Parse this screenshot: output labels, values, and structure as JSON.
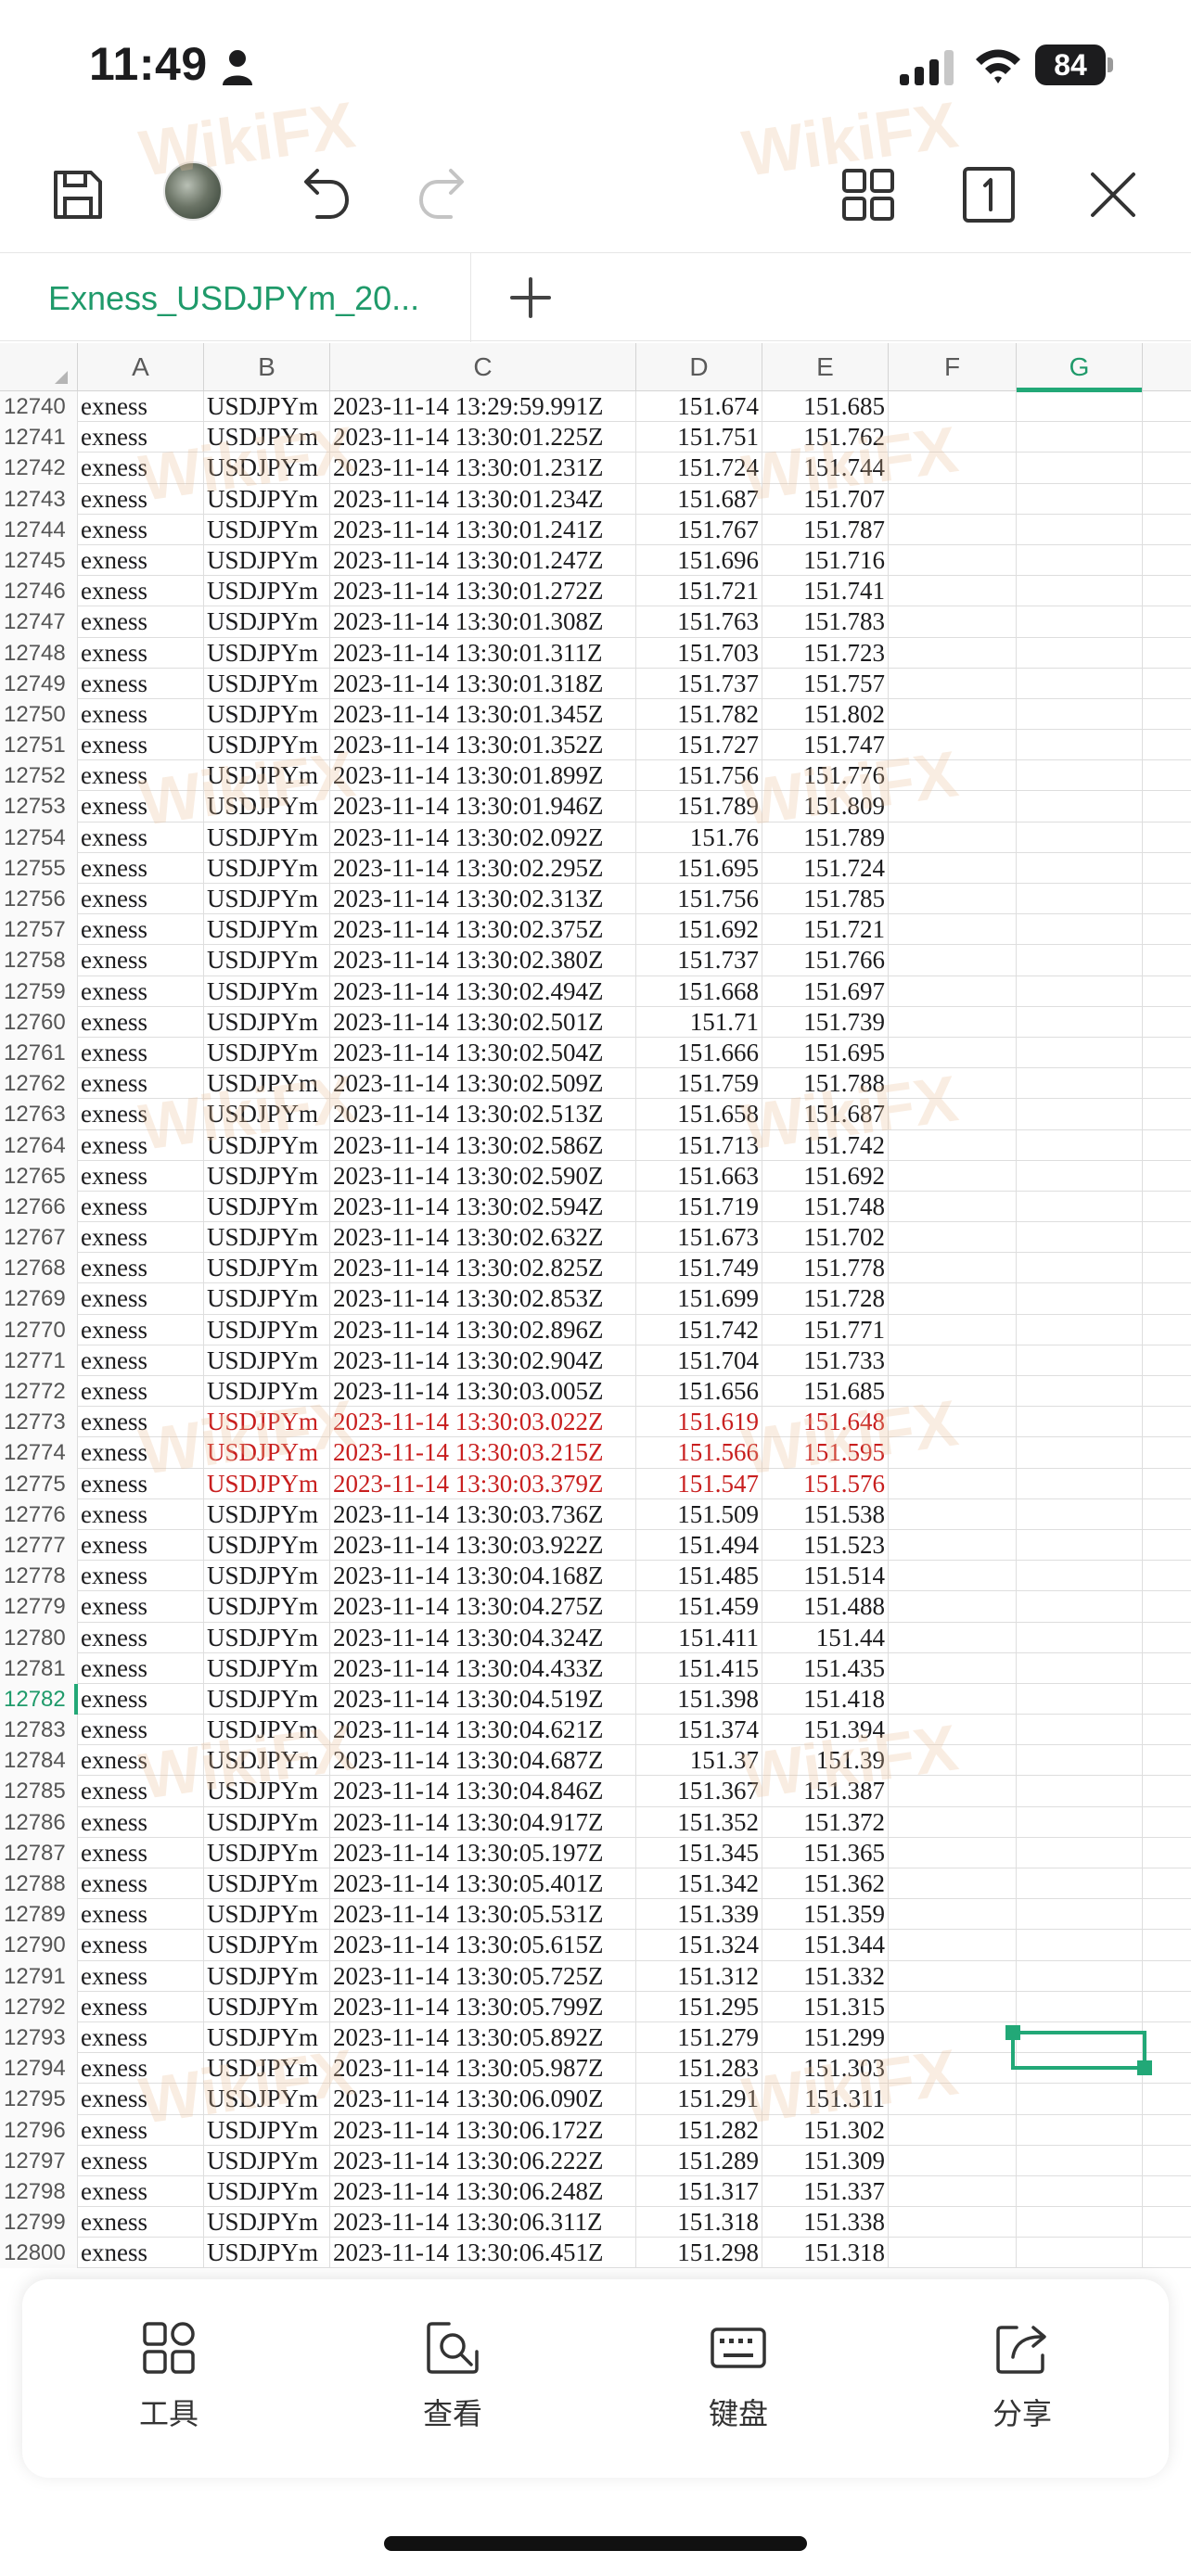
{
  "status_bar": {
    "time": "11:49",
    "battery": "84"
  },
  "sheet": {
    "tab_name": "Exness_USDJPYm_20..."
  },
  "columns": [
    "A",
    "B",
    "C",
    "D",
    "E",
    "F",
    "G"
  ],
  "active_column": "G",
  "rows": [
    [
      "12740",
      "exness",
      "USDJPYm",
      "2023-11-14 13:29:59.991Z",
      "151.674",
      "151.685"
    ],
    [
      "12741",
      "exness",
      "USDJPYm",
      "2023-11-14 13:30:01.225Z",
      "151.751",
      "151.762"
    ],
    [
      "12742",
      "exness",
      "USDJPYm",
      "2023-11-14 13:30:01.231Z",
      "151.724",
      "151.744"
    ],
    [
      "12743",
      "exness",
      "USDJPYm",
      "2023-11-14 13:30:01.234Z",
      "151.687",
      "151.707"
    ],
    [
      "12744",
      "exness",
      "USDJPYm",
      "2023-11-14 13:30:01.241Z",
      "151.767",
      "151.787"
    ],
    [
      "12745",
      "exness",
      "USDJPYm",
      "2023-11-14 13:30:01.247Z",
      "151.696",
      "151.716"
    ],
    [
      "12746",
      "exness",
      "USDJPYm",
      "2023-11-14 13:30:01.272Z",
      "151.721",
      "151.741"
    ],
    [
      "12747",
      "exness",
      "USDJPYm",
      "2023-11-14 13:30:01.308Z",
      "151.763",
      "151.783"
    ],
    [
      "12748",
      "exness",
      "USDJPYm",
      "2023-11-14 13:30:01.311Z",
      "151.703",
      "151.723"
    ],
    [
      "12749",
      "exness",
      "USDJPYm",
      "2023-11-14 13:30:01.318Z",
      "151.737",
      "151.757"
    ],
    [
      "12750",
      "exness",
      "USDJPYm",
      "2023-11-14 13:30:01.345Z",
      "151.782",
      "151.802"
    ],
    [
      "12751",
      "exness",
      "USDJPYm",
      "2023-11-14 13:30:01.352Z",
      "151.727",
      "151.747"
    ],
    [
      "12752",
      "exness",
      "USDJPYm",
      "2023-11-14 13:30:01.899Z",
      "151.756",
      "151.776"
    ],
    [
      "12753",
      "exness",
      "USDJPYm",
      "2023-11-14 13:30:01.946Z",
      "151.789",
      "151.809"
    ],
    [
      "12754",
      "exness",
      "USDJPYm",
      "2023-11-14 13:30:02.092Z",
      "151.76",
      "151.789"
    ],
    [
      "12755",
      "exness",
      "USDJPYm",
      "2023-11-14 13:30:02.295Z",
      "151.695",
      "151.724"
    ],
    [
      "12756",
      "exness",
      "USDJPYm",
      "2023-11-14 13:30:02.313Z",
      "151.756",
      "151.785"
    ],
    [
      "12757",
      "exness",
      "USDJPYm",
      "2023-11-14 13:30:02.375Z",
      "151.692",
      "151.721"
    ],
    [
      "12758",
      "exness",
      "USDJPYm",
      "2023-11-14 13:30:02.380Z",
      "151.737",
      "151.766"
    ],
    [
      "12759",
      "exness",
      "USDJPYm",
      "2023-11-14 13:30:02.494Z",
      "151.668",
      "151.697"
    ],
    [
      "12760",
      "exness",
      "USDJPYm",
      "2023-11-14 13:30:02.501Z",
      "151.71",
      "151.739"
    ],
    [
      "12761",
      "exness",
      "USDJPYm",
      "2023-11-14 13:30:02.504Z",
      "151.666",
      "151.695"
    ],
    [
      "12762",
      "exness",
      "USDJPYm",
      "2023-11-14 13:30:02.509Z",
      "151.759",
      "151.788"
    ],
    [
      "12763",
      "exness",
      "USDJPYm",
      "2023-11-14 13:30:02.513Z",
      "151.658",
      "151.687"
    ],
    [
      "12764",
      "exness",
      "USDJPYm",
      "2023-11-14 13:30:02.586Z",
      "151.713",
      "151.742"
    ],
    [
      "12765",
      "exness",
      "USDJPYm",
      "2023-11-14 13:30:02.590Z",
      "151.663",
      "151.692"
    ],
    [
      "12766",
      "exness",
      "USDJPYm",
      "2023-11-14 13:30:02.594Z",
      "151.719",
      "151.748"
    ],
    [
      "12767",
      "exness",
      "USDJPYm",
      "2023-11-14 13:30:02.632Z",
      "151.673",
      "151.702"
    ],
    [
      "12768",
      "exness",
      "USDJPYm",
      "2023-11-14 13:30:02.825Z",
      "151.749",
      "151.778"
    ],
    [
      "12769",
      "exness",
      "USDJPYm",
      "2023-11-14 13:30:02.853Z",
      "151.699",
      "151.728"
    ],
    [
      "12770",
      "exness",
      "USDJPYm",
      "2023-11-14 13:30:02.896Z",
      "151.742",
      "151.771"
    ],
    [
      "12771",
      "exness",
      "USDJPYm",
      "2023-11-14 13:30:02.904Z",
      "151.704",
      "151.733"
    ],
    [
      "12772",
      "exness",
      "USDJPYm",
      "2023-11-14 13:30:03.005Z",
      "151.656",
      "151.685"
    ],
    [
      "12773",
      "exness",
      "USDJPYm",
      "2023-11-14 13:30:03.022Z",
      "151.619",
      "151.648"
    ],
    [
      "12774",
      "exness",
      "USDJPYm",
      "2023-11-14 13:30:03.215Z",
      "151.566",
      "151.595"
    ],
    [
      "12775",
      "exness",
      "USDJPYm",
      "2023-11-14 13:30:03.379Z",
      "151.547",
      "151.576"
    ],
    [
      "12776",
      "exness",
      "USDJPYm",
      "2023-11-14 13:30:03.736Z",
      "151.509",
      "151.538"
    ],
    [
      "12777",
      "exness",
      "USDJPYm",
      "2023-11-14 13:30:03.922Z",
      "151.494",
      "151.523"
    ],
    [
      "12778",
      "exness",
      "USDJPYm",
      "2023-11-14 13:30:04.168Z",
      "151.485",
      "151.514"
    ],
    [
      "12779",
      "exness",
      "USDJPYm",
      "2023-11-14 13:30:04.275Z",
      "151.459",
      "151.488"
    ],
    [
      "12780",
      "exness",
      "USDJPYm",
      "2023-11-14 13:30:04.324Z",
      "151.411",
      "151.44"
    ],
    [
      "12781",
      "exness",
      "USDJPYm",
      "2023-11-14 13:30:04.433Z",
      "151.415",
      "151.435"
    ],
    [
      "12782",
      "exness",
      "USDJPYm",
      "2023-11-14 13:30:04.519Z",
      "151.398",
      "151.418"
    ],
    [
      "12783",
      "exness",
      "USDJPYm",
      "2023-11-14 13:30:04.621Z",
      "151.374",
      "151.394"
    ],
    [
      "12784",
      "exness",
      "USDJPYm",
      "2023-11-14 13:30:04.687Z",
      "151.37",
      "151.39"
    ],
    [
      "12785",
      "exness",
      "USDJPYm",
      "2023-11-14 13:30:04.846Z",
      "151.367",
      "151.387"
    ],
    [
      "12786",
      "exness",
      "USDJPYm",
      "2023-11-14 13:30:04.917Z",
      "151.352",
      "151.372"
    ],
    [
      "12787",
      "exness",
      "USDJPYm",
      "2023-11-14 13:30:05.197Z",
      "151.345",
      "151.365"
    ],
    [
      "12788",
      "exness",
      "USDJPYm",
      "2023-11-14 13:30:05.401Z",
      "151.342",
      "151.362"
    ],
    [
      "12789",
      "exness",
      "USDJPYm",
      "2023-11-14 13:30:05.531Z",
      "151.339",
      "151.359"
    ],
    [
      "12790",
      "exness",
      "USDJPYm",
      "2023-11-14 13:30:05.615Z",
      "151.324",
      "151.344"
    ],
    [
      "12791",
      "exness",
      "USDJPYm",
      "2023-11-14 13:30:05.725Z",
      "151.312",
      "151.332"
    ],
    [
      "12792",
      "exness",
      "USDJPYm",
      "2023-11-14 13:30:05.799Z",
      "151.295",
      "151.315"
    ],
    [
      "12793",
      "exness",
      "USDJPYm",
      "2023-11-14 13:30:05.892Z",
      "151.279",
      "151.299"
    ],
    [
      "12794",
      "exness",
      "USDJPYm",
      "2023-11-14 13:30:05.987Z",
      "151.283",
      "151.303"
    ],
    [
      "12795",
      "exness",
      "USDJPYm",
      "2023-11-14 13:30:06.090Z",
      "151.291",
      "151.311"
    ],
    [
      "12796",
      "exness",
      "USDJPYm",
      "2023-11-14 13:30:06.172Z",
      "151.282",
      "151.302"
    ],
    [
      "12797",
      "exness",
      "USDJPYm",
      "2023-11-14 13:30:06.222Z",
      "151.289",
      "151.309"
    ],
    [
      "12798",
      "exness",
      "USDJPYm",
      "2023-11-14 13:30:06.248Z",
      "151.317",
      "151.337"
    ],
    [
      "12799",
      "exness",
      "USDJPYm",
      "2023-11-14 13:30:06.311Z",
      "151.318",
      "151.338"
    ],
    [
      "12800",
      "exness",
      "USDJPYm",
      "2023-11-14 13:30:06.451Z",
      "151.298",
      "151.318"
    ]
  ],
  "highlighted_rows": [
    "12773",
    "12774",
    "12775"
  ],
  "selected_row": "12782",
  "watermark": "WikiFX",
  "bottom_toolbar": {
    "tools": "工具",
    "view": "查看",
    "keyboard": "键盘",
    "share": "分享"
  },
  "colors": {
    "accent": "#22a877",
    "highlight_text": "#c81e1e"
  }
}
